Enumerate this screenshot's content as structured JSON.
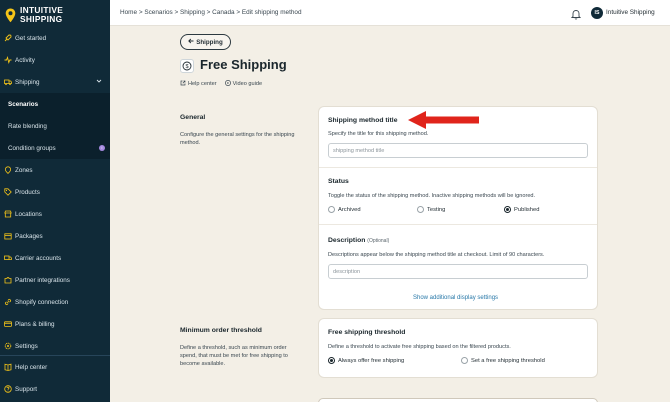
{
  "brand": {
    "line1": "INTUITIVE",
    "line2": "SHIPPING"
  },
  "sidebar": {
    "items": [
      {
        "label": "Get started",
        "icon": "rocket-icon"
      },
      {
        "label": "Activity",
        "icon": "activity-icon"
      },
      {
        "label": "Shipping",
        "icon": "truck-icon"
      },
      {
        "label": "Scenarios"
      },
      {
        "label": "Rate blending"
      },
      {
        "label": "Condition groups",
        "badge": "i"
      },
      {
        "label": "Zones",
        "icon": "pin-icon"
      },
      {
        "label": "Products",
        "icon": "tag-icon"
      },
      {
        "label": "Locations",
        "icon": "store-icon"
      },
      {
        "label": "Packages",
        "icon": "box-icon"
      },
      {
        "label": "Carrier accounts",
        "icon": "truck-icon"
      },
      {
        "label": "Partner integrations",
        "icon": "puzzle-icon"
      },
      {
        "label": "Shopify connection",
        "icon": "link-icon"
      },
      {
        "label": "Plans & billing",
        "icon": "card-icon"
      },
      {
        "label": "Settings",
        "icon": "gear-icon"
      }
    ],
    "bottom": [
      {
        "label": "Help center",
        "icon": "book-icon"
      },
      {
        "label": "Support",
        "icon": "help-icon"
      }
    ]
  },
  "topbar": {
    "breadcrumb": "Home > Scenarios > Shipping > Canada > Edit shipping method",
    "avatar_initials": "IS",
    "account_name": "Intuitive Shipping"
  },
  "page": {
    "back_label": "Shipping",
    "title": "Free Shipping",
    "help_center": "Help center",
    "video_guide": "Video guide"
  },
  "general": {
    "title": "General",
    "desc": "Configure the general settings for the shipping method.",
    "method_title": {
      "label": "Shipping method title",
      "desc": "Specify the title for this shipping method.",
      "placeholder": "shipping method title",
      "value": ""
    },
    "status": {
      "label": "Status",
      "desc": "Toggle the status of the shipping method. Inactive shipping methods will be ignored.",
      "options": [
        "Archived",
        "Testing",
        "Published"
      ],
      "selected": "Published"
    },
    "description": {
      "label": "Description",
      "optional": "(Optional)",
      "desc": "Descriptions appear below the shipping method title at checkout. Limit of 90 characters.",
      "placeholder": "description",
      "value": ""
    },
    "show_more": "Show additional display settings"
  },
  "min_order": {
    "title": "Minimum order threshold",
    "desc": "Define a threshold, such as minimum order spend, that must be met for free shipping to become available.",
    "card_title": "Free shipping threshold",
    "card_desc": "Define a threshold to activate free shipping based on the filtered products.",
    "options": [
      "Always offer free shipping",
      "Set a free shipping threshold"
    ],
    "selected": "Always offer free shipping"
  },
  "colors": {
    "sidebar_bg": "#102a38",
    "page_bg": "#f3efe6",
    "accent_link": "#2878a8",
    "annotation_arrow": "#e0241b",
    "brand_yellow": "#f5c518"
  }
}
